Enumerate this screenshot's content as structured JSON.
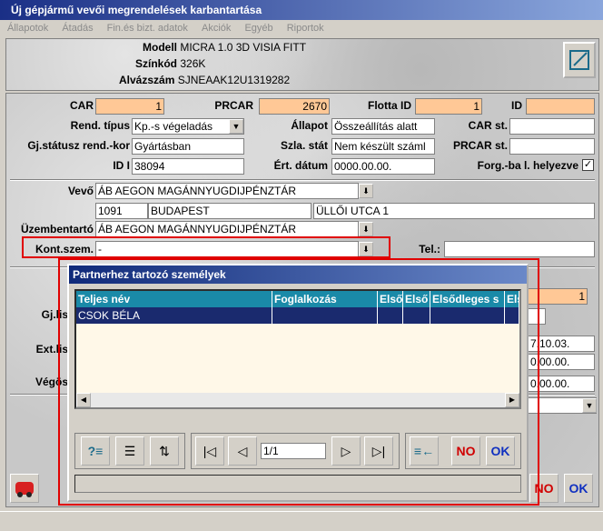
{
  "window": {
    "title": "Új gépjármű vevői megrendelések karbantartása"
  },
  "menu": [
    "Állapotok",
    "Átadás",
    "Fin.és bizt. adatok",
    "Akciók",
    "Egyéb",
    "Riportok"
  ],
  "header": {
    "modell_label": "Modell",
    "modell_value": "MICRA 1.0 3D VISIA FITT",
    "szinkod_label": "Színkód",
    "szinkod_value": "326K",
    "alvazszam_label": "Alvázszám",
    "alvazszam_value": "SJNEAAK12U1319282"
  },
  "form": {
    "car_label": "CAR",
    "car_value": "1",
    "prcar_label": "PRCAR",
    "prcar_value": "2670",
    "flotta_label": "Flotta ID",
    "flotta_value": "1",
    "id_label": "ID",
    "id_value": "",
    "rend_tipus_label": "Rend. típus",
    "rend_tipus_value": "Kp.-s végeladás",
    "allapot_label": "Állapot",
    "allapot_value": "Összeállítás alatt",
    "car_st_label": "CAR st.",
    "car_st_value": "",
    "gjstatusz_label": "Gj.státusz rend.-kor",
    "gjstatusz_value": "Gyártásban",
    "szla_stat_label": "Szla. stát",
    "szla_stat_value": "Nem készült száml",
    "prcar_st_label": "PRCAR st.",
    "prcar_st_value": "",
    "id2_label": "ID I",
    "id2_value": "38094",
    "ert_datum_label": "Ért. dátum",
    "ert_datum_value": "0000.00.00.",
    "forg_label": "Forg.-ba l. helyezve",
    "forg_checked": "✓",
    "vevo_label": "Vevő",
    "vevo_value": "ÁB AEGON MAGÁNNYUGDIJPÉNZTÁR",
    "irsz_value": "1091",
    "varos_value": "BUDAPEST",
    "utca_value": "ÜLLŐI UTCA 1",
    "uzembentarto_label": "Üzembentartó",
    "uzembentarto_value": "ÁB AEGON MAGÁNNYUGDIJPÉNZTÁR",
    "kont_label": "Kont.szem.",
    "kont_value": "-",
    "tel_label": "Tel.:",
    "tel_value": "",
    "gj_label": "Gj.lis",
    "ext_label": "Ext.lis",
    "veg_label": "Végös",
    "right_val1": "1",
    "right_date1": "7.10.03.",
    "right_date2": "0.00.00.",
    "right_date3": "0.00.00."
  },
  "dialog": {
    "title": "Partnerhez tartozó személyek",
    "columns": [
      "Teljes név",
      "Foglalkozás",
      "Első",
      "Első",
      "Elsődleges s",
      "Els"
    ],
    "rows": [
      {
        "name": "CSOK BÉLA"
      }
    ],
    "page": "1/1",
    "no_label": "NO",
    "ok_label": "OK"
  },
  "main_buttons": {
    "no_label": "NO",
    "ok_label": "OK"
  },
  "colors": {
    "orange_field": "#ffc896",
    "highlight": "#e00000",
    "grid_header": "#1a8aa8",
    "grid_row": "#1a2a6e"
  }
}
